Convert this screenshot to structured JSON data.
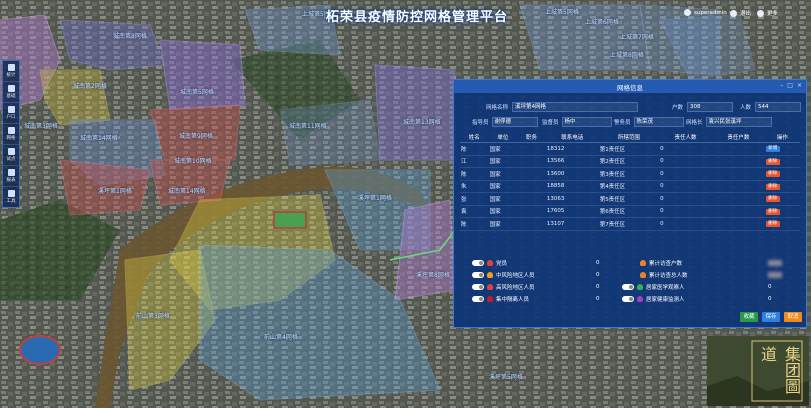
{
  "app": {
    "title": "柘荣县疫情防控网格管理平台"
  },
  "topbar": {
    "user": "superadmin",
    "menu_1": "退出",
    "menu_2": "更多"
  },
  "sidebar": {
    "items": [
      {
        "label": "统计"
      },
      {
        "label": "基础"
      },
      {
        "label": "户口"
      },
      {
        "label": "网格"
      },
      {
        "label": "试点"
      },
      {
        "label": "报表"
      },
      {
        "label": "工具"
      }
    ]
  },
  "map": {
    "zones": [
      {
        "name": "城南第1网格",
        "color": "#b07ad0"
      },
      {
        "name": "城南第2网格",
        "color": "#6f6fd8"
      },
      {
        "name": "城南第3网格",
        "color": "#d4c23c"
      },
      {
        "name": "城南第5网格",
        "color": "#8a6bd6"
      },
      {
        "name": "城南第6网格",
        "color": "#c05050"
      },
      {
        "name": "城南第7网格",
        "color": "#6a8fd8"
      },
      {
        "name": "城南第8网格",
        "color": "#8a6bd6"
      },
      {
        "name": "城南第9网格",
        "color": "#c05050"
      },
      {
        "name": "城南第10网格",
        "color": "#c05050"
      },
      {
        "name": "城南第11网格",
        "color": "#6f9ad8"
      },
      {
        "name": "城南第12网格",
        "color": "#7b6fd0"
      },
      {
        "name": "城南第13网格",
        "color": "#6f9ad8"
      },
      {
        "name": "城南第14网格",
        "color": "#c05050"
      },
      {
        "name": "溪坪第1网格",
        "color": "#5aa0d8"
      },
      {
        "name": "溪坪第4网格",
        "color": "#6f9ad8"
      },
      {
        "name": "溪坪第5网格",
        "color": "#6f9ad8"
      },
      {
        "name": "溪坪第8网格",
        "color": "#b07ad0"
      },
      {
        "name": "前山第3网格",
        "color": "#e0d040"
      },
      {
        "name": "前山第4网格",
        "color": "#5aa0d8"
      },
      {
        "name": "上城第5网格",
        "color": "#6f9ad8"
      },
      {
        "name": "上城第6网格",
        "color": "#6f9ad8"
      },
      {
        "name": "上城第7网格",
        "color": "#6f9ad8"
      },
      {
        "name": "上城第8网格",
        "color": "#6f9ad8"
      }
    ]
  },
  "panel": {
    "title": "网格信息",
    "fields": {
      "grid_name_label": "网格名称",
      "grid_name_value": "溪坪第4网格",
      "households_label": "户数",
      "households_value": "308",
      "persons_label": "人数",
      "persons_value": "544",
      "leader_label": "指导员",
      "leader_value": "谢俘德",
      "supervisor_label": "监督员",
      "supervisor_value": "杨中",
      "police_label": "警务员",
      "police_value": "陈荣茂",
      "gridman_label": "网格长",
      "gridman_value": "袁兴民张溪坪"
    },
    "columns": [
      "姓名",
      "单位",
      "职务",
      "联系电话",
      "所辖范围",
      "责任人数",
      "责任户数",
      "操作"
    ],
    "rows": [
      {
        "name": "陈",
        "unit": "国家",
        "duty": "",
        "phone": "18312",
        "range": "第1责任区",
        "people": "0",
        "homes": "",
        "op": "新增",
        "op_color": "blue"
      },
      {
        "name": "江",
        "unit": "国家",
        "duty": "",
        "phone": "13566",
        "range": "第2责任区",
        "people": "0",
        "homes": "",
        "op": "删除",
        "op_color": "red"
      },
      {
        "name": "陈",
        "unit": "国家",
        "duty": "",
        "phone": "13600",
        "range": "第3责任区",
        "people": "0",
        "homes": "",
        "op": "删除",
        "op_color": "red"
      },
      {
        "name": "朱",
        "unit": "国家",
        "duty": "",
        "phone": "18858",
        "range": "第4责任区",
        "people": "0",
        "homes": "",
        "op": "删除",
        "op_color": "red"
      },
      {
        "name": "张",
        "unit": "国家",
        "duty": "",
        "phone": "13063",
        "range": "第5责任区",
        "people": "0",
        "homes": "",
        "op": "删除",
        "op_color": "red"
      },
      {
        "name": "袁",
        "unit": "国家",
        "duty": "",
        "phone": "17605",
        "range": "第6责任区",
        "people": "0",
        "homes": "",
        "op": "删除",
        "op_color": "red"
      },
      {
        "name": "陈",
        "unit": "国家",
        "duty": "",
        "phone": "13107",
        "range": "第7责任区",
        "people": "0",
        "homes": "",
        "op": "删除",
        "op_color": "red"
      }
    ],
    "stats": [
      {
        "label": "党员",
        "value": "0"
      },
      {
        "label": "累计访查户数",
        "value": ""
      },
      {
        "label": "中风险地区人员",
        "value": "0"
      },
      {
        "label": "累计访查总人数",
        "value": ""
      },
      {
        "label": "高风险地区人员",
        "value": "0"
      },
      {
        "label": "居家医学观察人",
        "value": "0"
      },
      {
        "label": "集中隔离人员",
        "value": "0"
      },
      {
        "label": "居家健康监测人",
        "value": "0"
      }
    ],
    "buttons": {
      "confirm": "收藏",
      "save": "保存",
      "close": "取消"
    }
  },
  "thumbnail": {
    "caption": "集团圖道"
  }
}
